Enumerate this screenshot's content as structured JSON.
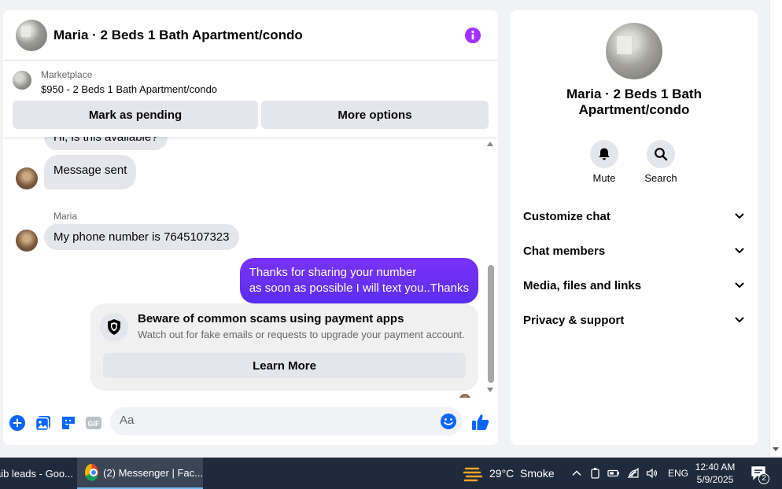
{
  "header": {
    "title": "Maria · 2 Beds 1 Bath Apartment/condo"
  },
  "marketplace": {
    "label": "Marketplace",
    "listing": "$950 - 2 Beds 1 Bath Apartment/condo",
    "mark_pending": "Mark as pending",
    "more_options": "More options"
  },
  "messages": {
    "partial_first": "Hi, is this available?",
    "sent_notice": "Message sent",
    "sender_name": "Maria",
    "phone_msg": "My phone number is 7645107323",
    "reply_line1": "Thanks for sharing your number",
    "reply_line2": "as soon as possible I will text you..Thanks"
  },
  "scam_warning": {
    "title": "Beware of common scams using payment apps",
    "subtitle": "Watch out for fake emails or requests to upgrade your payment account.",
    "button": "Learn More"
  },
  "composer": {
    "placeholder": "Aa",
    "gif_label": "GIF"
  },
  "details": {
    "title": "Maria · 2 Beds 1 Bath Apartment/condo",
    "actions": {
      "mute": "Mute",
      "search": "Search"
    },
    "sections": [
      "Customize chat",
      "Chat members",
      "Media, files and links",
      "Privacy & support"
    ]
  },
  "taskbar": {
    "item1": "aib leads - Goo...",
    "item2": "(2) Messenger | Fac...",
    "weather": "29°C  Smoke",
    "language": "ENG",
    "time": "12:40 AM",
    "date": "5/9/2025",
    "notification_count": "2"
  },
  "colors": {
    "accent": "#a033ff",
    "outgoing_bubble": "#6c2bf5",
    "messenger_blue": "#0866ff"
  }
}
